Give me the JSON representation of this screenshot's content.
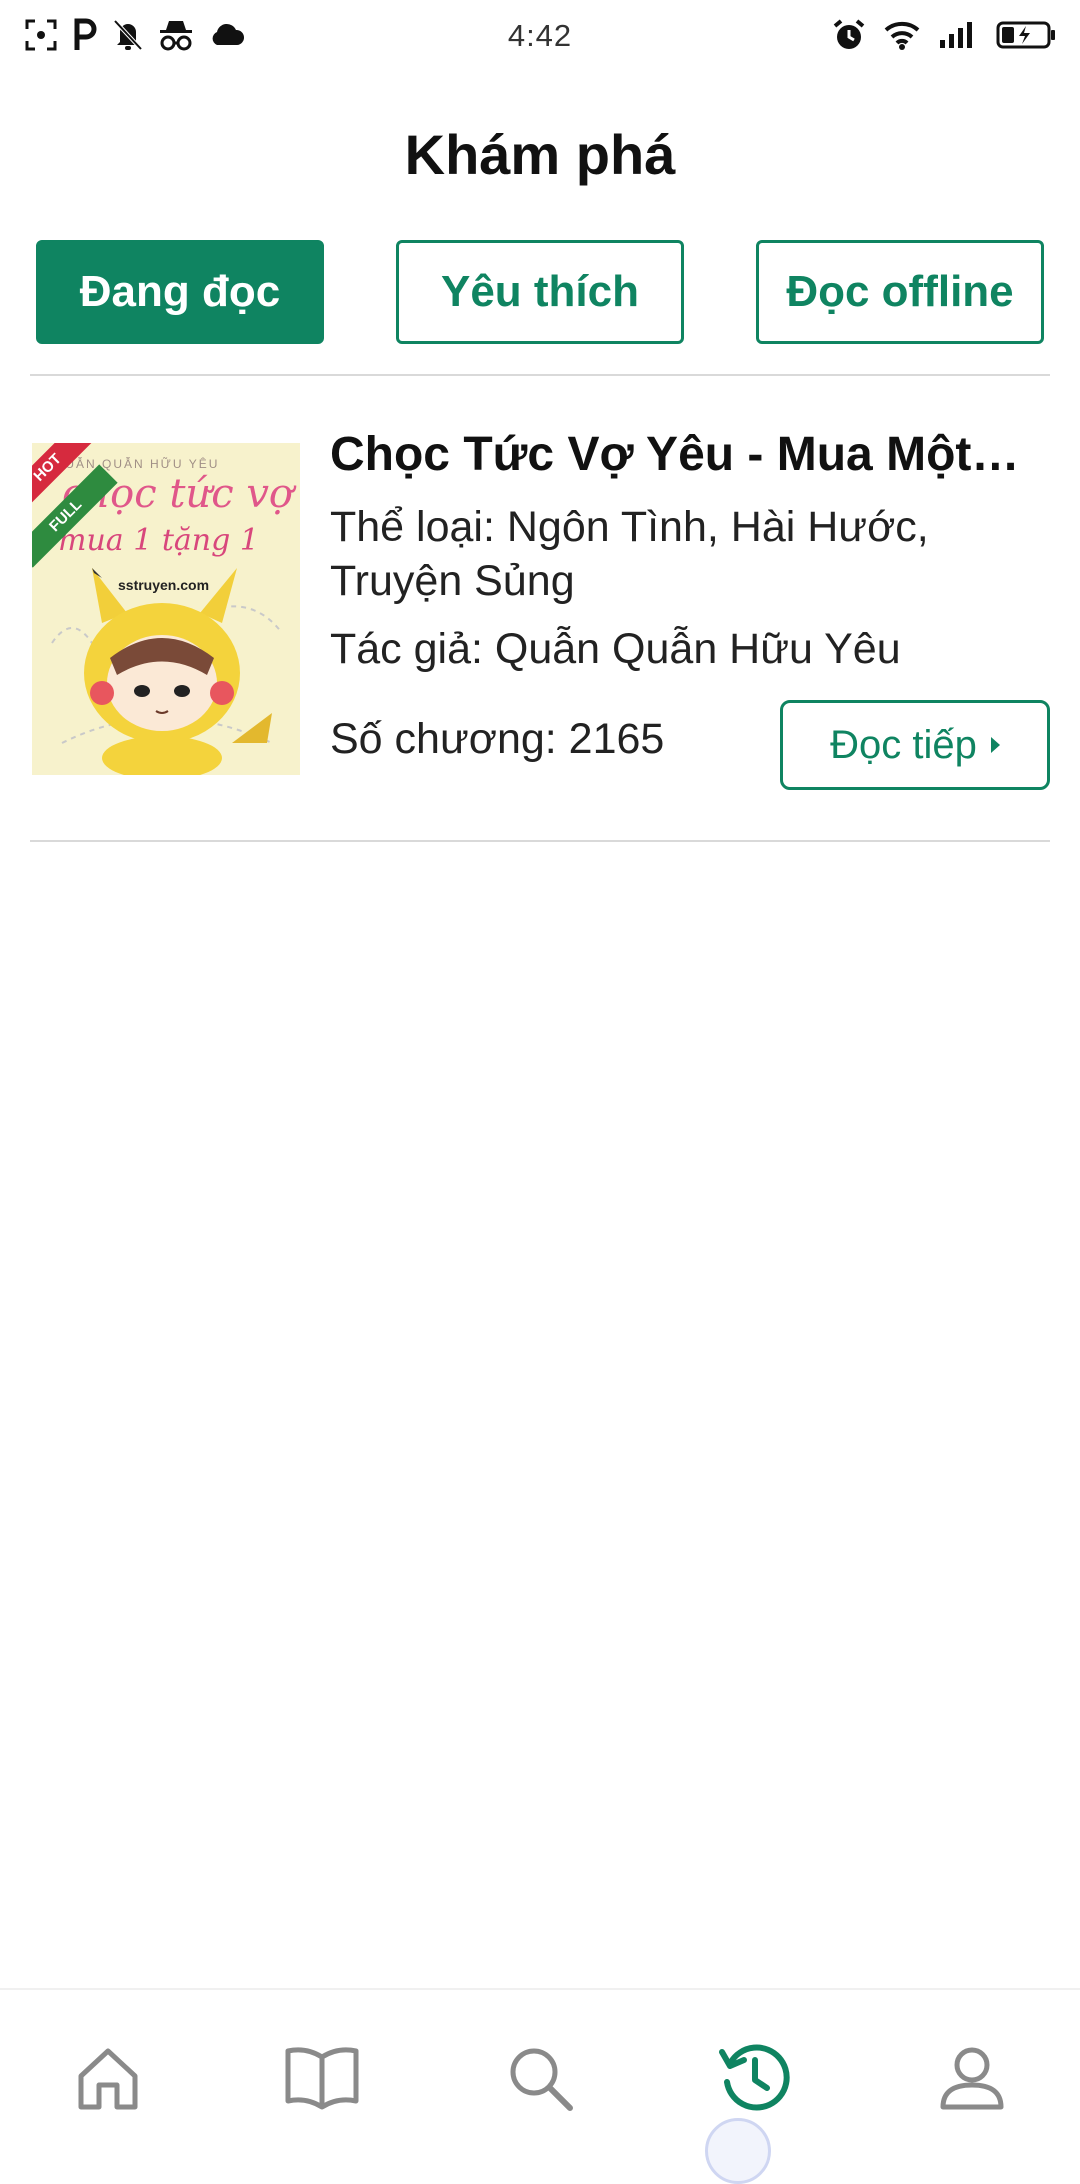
{
  "status_bar": {
    "time": "4:42",
    "left_icons": [
      "screenshot-icon",
      "parking-p-icon",
      "bell-muted-icon",
      "incognito-icon",
      "cloud-icon"
    ],
    "right_icons": [
      "alarm-icon",
      "wifi-icon",
      "signal-icon",
      "battery-charging-icon"
    ]
  },
  "header": {
    "title": "Khám phá"
  },
  "tabs": [
    {
      "label": "Đang đọc",
      "active": true
    },
    {
      "label": "Yêu thích",
      "active": false
    },
    {
      "label": "Đọc offline",
      "active": false
    }
  ],
  "book": {
    "title": "Chọc Tức Vợ Yêu - Mua Một Tặng Một",
    "genre": "Thể loại:  Ngôn Tình, Hài Hước, Truyện Sủng",
    "author": "Tác giả:  Quẫn Quẫn Hữu Yêu",
    "chapters": "Số chương: 2165",
    "continue_label": "Đọc tiếp",
    "cover": {
      "badge_hot": "HOT",
      "badge_full": "FULL",
      "top_text": "QUẪN QUẪN HỮU YÊU",
      "title_line1": "chọc tức vợ yêu",
      "title_line2": "mua 1 tặng 1",
      "site": "sstruyen.com"
    }
  },
  "bottom_nav": {
    "items": [
      {
        "icon": "home-icon",
        "active": false
      },
      {
        "icon": "book-icon",
        "active": false
      },
      {
        "icon": "search-icon",
        "active": false
      },
      {
        "icon": "history-icon",
        "active": true
      },
      {
        "icon": "profile-icon",
        "active": false
      }
    ]
  },
  "colors": {
    "accent": "#0f8461",
    "icon_gray": "#8a8a8a",
    "divider": "#d9d9d9",
    "hot_badge": "#d62a3e",
    "full_badge": "#2e8b3f"
  }
}
